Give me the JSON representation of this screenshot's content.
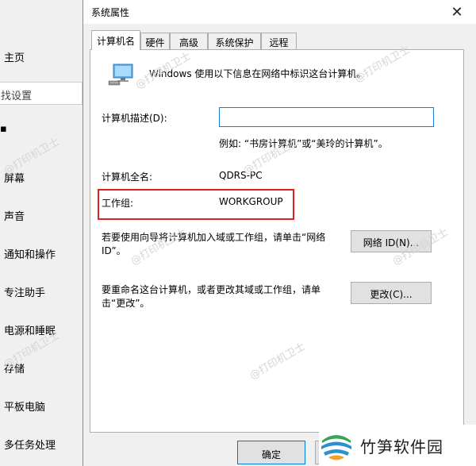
{
  "sidebar": {
    "search_placeholder": "找设置",
    "items": [
      "主页",
      "屏幕",
      "声音",
      "通知和操作",
      "专注助手",
      "电源和睡眠",
      "存储",
      "平板电脑",
      "多任务处理"
    ],
    "dot": "▪"
  },
  "dialog": {
    "title": "系统属性",
    "close_glyph": "✕",
    "tabs": [
      "计算机名",
      "硬件",
      "高级",
      "系统保护",
      "远程"
    ],
    "intro": "Windows 使用以下信息在网络中标识这台计算机。",
    "desc_label": "计算机描述(D):",
    "desc_value": "",
    "desc_example": "例如: “书房计算机”或“美玲的计算机”。",
    "fullname_label": "计算机全名:",
    "fullname_value": "QDRS-PC",
    "workgroup_label": "工作组:",
    "workgroup_value": "WORKGROUP",
    "network_text": "若要使用向导将计算机加入域或工作组，请单击“网络 ID”。",
    "network_button": "网络 ID(N)...",
    "rename_text": "要重命名这台计算机，或者更改其域或工作组，请单击“更改”。",
    "change_button": "更改(C)...",
    "ok_button": "确定"
  },
  "watermark": "@打印机卫士",
  "brand": {
    "name": "竹笋软件园",
    "colors": {
      "green": "#3aa55a",
      "blue": "#2d8fd0",
      "orange": "#f0a030"
    }
  },
  "colors": {
    "accent": "#0078d7",
    "highlight": "#e02020"
  }
}
